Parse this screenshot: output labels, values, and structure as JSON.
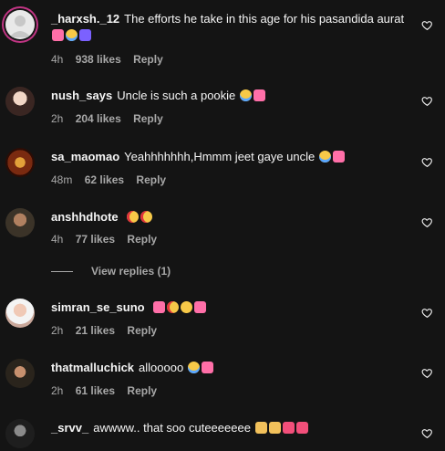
{
  "comments": [
    {
      "username": "_harxsh._12",
      "text": "The efforts he take in this age for his pasandida aurat",
      "emojis": [
        "heart-pink",
        "cry",
        "up"
      ],
      "time": "4h",
      "likes": "938 likes",
      "reply": "Reply"
    },
    {
      "username": "nush_says",
      "text": "Uncle is such a pookie",
      "emojis": [
        "cry",
        "heart-pink"
      ],
      "time": "2h",
      "likes": "204 likes",
      "reply": "Reply"
    },
    {
      "username": "sa_maomao",
      "text": "Yeahhhhhhh,Hmmm jeet gaye uncle",
      "emojis": [
        "cry",
        "heart-pink"
      ],
      "time": "48m",
      "likes": "62 likes",
      "reply": "Reply"
    },
    {
      "username": "anshhdhote",
      "text": "",
      "emojis": [
        "starstruck",
        "starstruck"
      ],
      "time": "4h",
      "likes": "77 likes",
      "reply": "Reply"
    },
    {
      "username": "simran_se_suno",
      "text": "",
      "emojis": [
        "heart-pink",
        "starstruck",
        "smile",
        "heart-pink"
      ],
      "time": "2h",
      "likes": "21 likes",
      "reply": "Reply"
    },
    {
      "username": "thatmalluchick",
      "text": "allooooo",
      "emojis": [
        "cry",
        "heart-pink"
      ],
      "time": "2h",
      "likes": "61 likes",
      "reply": "Reply"
    },
    {
      "username": "_srvv_",
      "text": "awwww.. that soo cuteeeeeee",
      "emojis": [
        "hands",
        "hands",
        "red-heart",
        "red-heart"
      ],
      "time": "",
      "likes": "",
      "reply": ""
    }
  ],
  "view_replies": "View replies (1)",
  "colors": {
    "background": "#141414",
    "text": "#f5f5f5",
    "muted": "#a8a8a8",
    "story_ring": "#c13584"
  }
}
